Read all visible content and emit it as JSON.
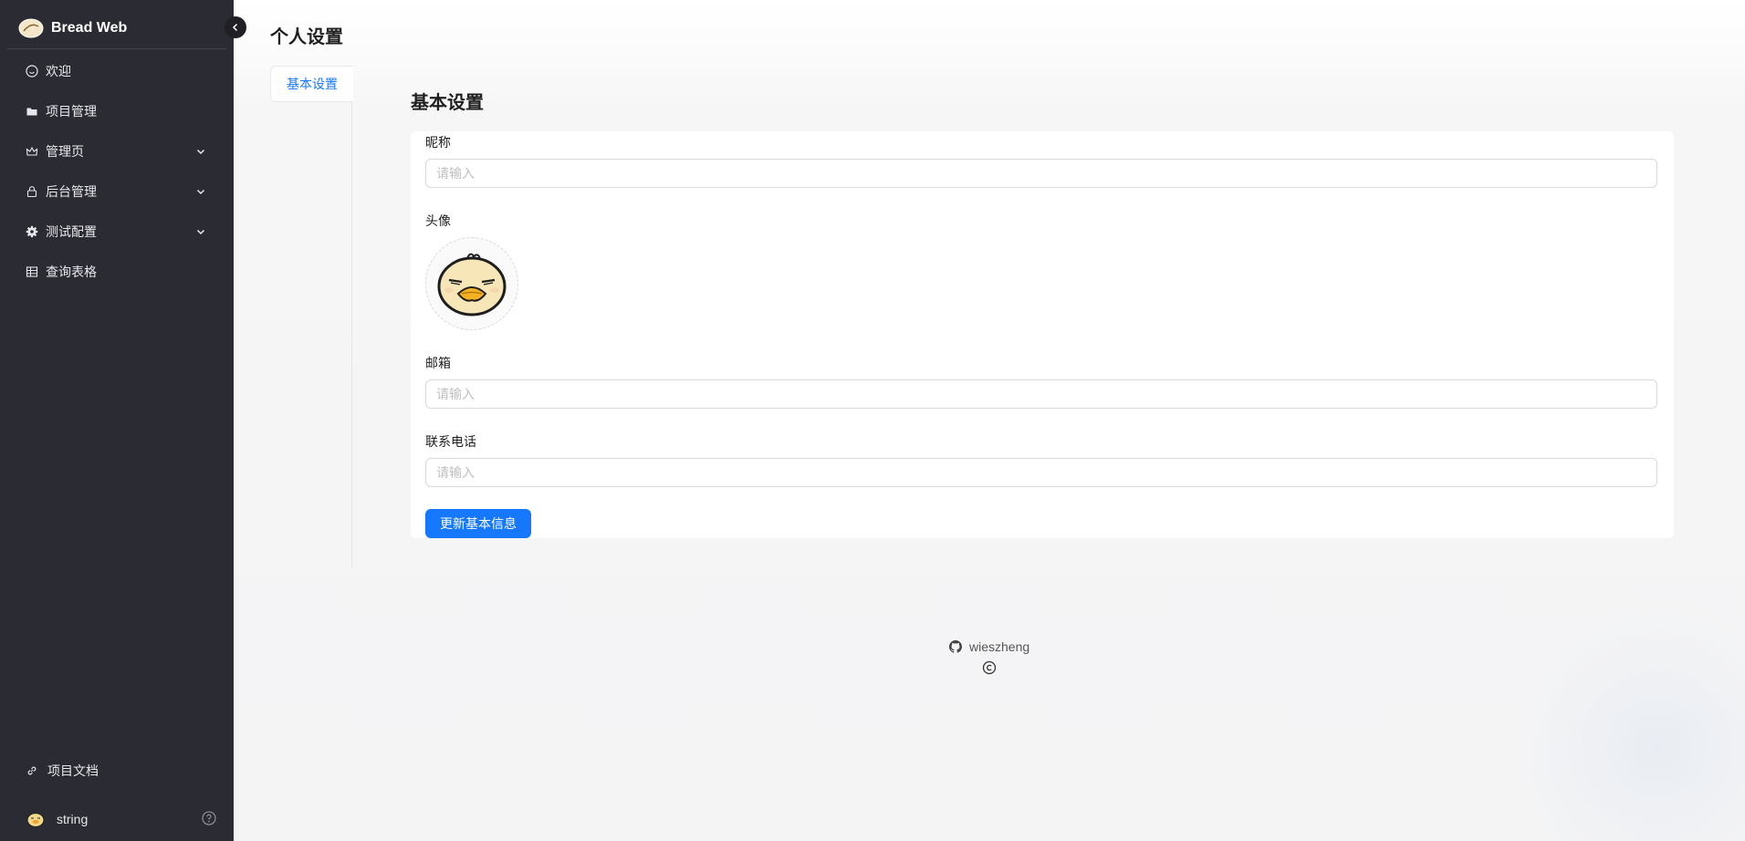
{
  "app": {
    "title": "Bread Web"
  },
  "sidebar": {
    "items": [
      {
        "label": "欢迎",
        "icon": "smile-icon",
        "expandable": false
      },
      {
        "label": "项目管理",
        "icon": "folder-icon",
        "expandable": false
      },
      {
        "label": "管理页",
        "icon": "crown-icon",
        "expandable": true
      },
      {
        "label": "后台管理",
        "icon": "lock-icon",
        "expandable": true
      },
      {
        "label": "测试配置",
        "icon": "gear-icon",
        "expandable": true
      },
      {
        "label": "查询表格",
        "icon": "table-icon",
        "expandable": false
      }
    ],
    "docs_link": "项目文档",
    "user_name": "string"
  },
  "page": {
    "title": "个人设置",
    "tabs": [
      {
        "label": "基本设置",
        "active": true
      }
    ],
    "section_title": "基本设置"
  },
  "form": {
    "nickname_label": "昵称",
    "nickname_placeholder": "请输入",
    "nickname_value": "",
    "avatar_label": "头像",
    "email_label": "邮箱",
    "email_placeholder": "请输入",
    "email_value": "",
    "phone_label": "联系电话",
    "phone_placeholder": "请输入",
    "phone_value": "",
    "submit_label": "更新基本信息"
  },
  "footer": {
    "link_text": "wieszheng"
  },
  "colors": {
    "sidebar_bg": "#2b2b33",
    "primary": "#1677ff",
    "page_bg": "#f5f5f6"
  }
}
